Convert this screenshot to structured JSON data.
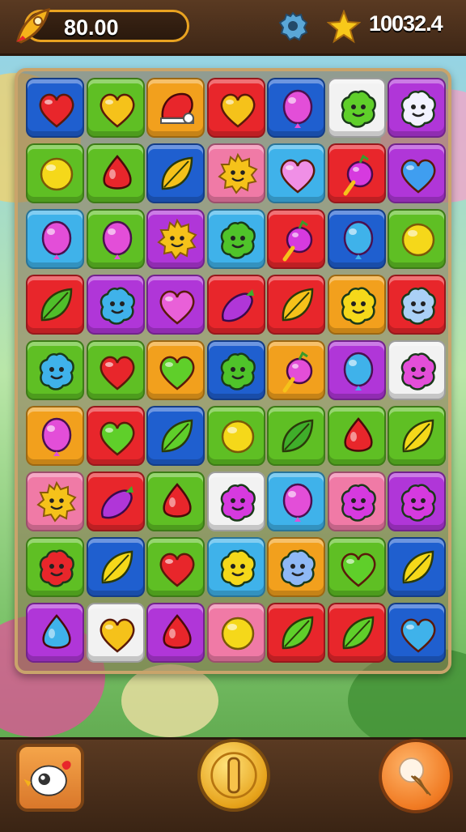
{
  "hud": {
    "coins": "80.00",
    "score": "10032.4",
    "coin_icon": "rocket-icon",
    "settings_icon": "gear-icon",
    "score_icon": "star-icon"
  },
  "colors": {
    "red": "#e8262b",
    "green": "#5fbf24",
    "orange": "#f2a01d",
    "blue": "#1f5fcf",
    "white": "#f2f2f2",
    "purple": "#b036d8",
    "cyan": "#3fb2ea",
    "pink": "#f07aa6"
  },
  "board": {
    "rows": [
      [
        {
          "bg": "blue",
          "icon": "heart",
          "c": "#e8262b"
        },
        {
          "bg": "green",
          "icon": "heart",
          "c": "#f5c21a"
        },
        {
          "bg": "orange",
          "icon": "cap",
          "c": "#e8262b"
        },
        {
          "bg": "red",
          "icon": "heart",
          "c": "#f5c21a"
        },
        {
          "bg": "blue",
          "icon": "balloon",
          "c": "#e34ed8"
        },
        {
          "bg": "white",
          "icon": "face-blob",
          "c": "#5fcf2a"
        },
        {
          "bg": "purple",
          "icon": "face-blob",
          "c": "#f2f2ff"
        }
      ],
      [
        {
          "bg": "green",
          "icon": "ball",
          "c": "#f5d81a"
        },
        {
          "bg": "green",
          "icon": "drop",
          "c": "#e8262b"
        },
        {
          "bg": "blue",
          "icon": "leaf",
          "c": "#f5c21a"
        },
        {
          "bg": "pink",
          "icon": "sun-face",
          "c": "#f5c21a"
        },
        {
          "bg": "cyan",
          "icon": "heart",
          "c": "#f08fe6"
        },
        {
          "bg": "red",
          "icon": "berry",
          "c": "#d63adf"
        },
        {
          "bg": "purple",
          "icon": "heart",
          "c": "#3f9ef0"
        }
      ],
      [
        {
          "bg": "cyan",
          "icon": "balloon",
          "c": "#e34ed8"
        },
        {
          "bg": "green",
          "icon": "balloon",
          "c": "#e34ed8"
        },
        {
          "bg": "purple",
          "icon": "sun-face",
          "c": "#f5c21a"
        },
        {
          "bg": "cyan",
          "icon": "face-blob",
          "c": "#4fc32a"
        },
        {
          "bg": "red",
          "icon": "berry",
          "c": "#d63adf"
        },
        {
          "bg": "blue",
          "icon": "balloon",
          "c": "#3fb2ea"
        },
        {
          "bg": "green",
          "icon": "ball",
          "c": "#f5d81a"
        }
      ],
      [
        {
          "bg": "red",
          "icon": "leaf",
          "c": "#4fbf2a"
        },
        {
          "bg": "purple",
          "icon": "face-blob",
          "c": "#3fb2ea"
        },
        {
          "bg": "purple",
          "icon": "heart",
          "c": "#e960d8"
        },
        {
          "bg": "red",
          "icon": "eggplant",
          "c": "#b036d8"
        },
        {
          "bg": "red",
          "icon": "leaf",
          "c": "#f5c21a"
        },
        {
          "bg": "orange",
          "icon": "face-blob",
          "c": "#f5d81a"
        },
        {
          "bg": "red",
          "icon": "face-blob",
          "c": "#aad0f5"
        }
      ],
      [
        {
          "bg": "green",
          "icon": "face-blob",
          "c": "#3fb2ea"
        },
        {
          "bg": "green",
          "icon": "heart",
          "c": "#e8262b"
        },
        {
          "bg": "orange",
          "icon": "heart",
          "c": "#5fcf2a"
        },
        {
          "bg": "blue",
          "icon": "face-blob",
          "c": "#4fc32a"
        },
        {
          "bg": "orange",
          "icon": "berry",
          "c": "#e34ed8"
        },
        {
          "bg": "purple",
          "icon": "balloon",
          "c": "#3fb2ea"
        },
        {
          "bg": "white",
          "icon": "face-blob",
          "c": "#e34ed8"
        }
      ],
      [
        {
          "bg": "orange",
          "icon": "balloon",
          "c": "#e34ed8"
        },
        {
          "bg": "red",
          "icon": "heart",
          "c": "#5fcf2a"
        },
        {
          "bg": "blue",
          "icon": "leaf",
          "c": "#5fcf2a"
        },
        {
          "bg": "green",
          "icon": "ball",
          "c": "#f5d81a"
        },
        {
          "bg": "green",
          "icon": "leaf",
          "c": "#3fae2a"
        },
        {
          "bg": "green",
          "icon": "drop",
          "c": "#e8262b"
        },
        {
          "bg": "green",
          "icon": "leaf",
          "c": "#f5d81a"
        }
      ],
      [
        {
          "bg": "pink",
          "icon": "sun-face",
          "c": "#f5c21a"
        },
        {
          "bg": "red",
          "icon": "eggplant",
          "c": "#b036d8"
        },
        {
          "bg": "green",
          "icon": "drop",
          "c": "#e8262b"
        },
        {
          "bg": "white",
          "icon": "face-blob",
          "c": "#d63adf"
        },
        {
          "bg": "cyan",
          "icon": "balloon",
          "c": "#e34ed8"
        },
        {
          "bg": "pink",
          "icon": "face-blob",
          "c": "#d63adf"
        },
        {
          "bg": "purple",
          "icon": "face-blob",
          "c": "#d63adf"
        }
      ],
      [
        {
          "bg": "green",
          "icon": "face-blob",
          "c": "#e8262b"
        },
        {
          "bg": "blue",
          "icon": "leaf",
          "c": "#f5d81a"
        },
        {
          "bg": "green",
          "icon": "heart",
          "c": "#e8262b"
        },
        {
          "bg": "cyan",
          "icon": "face-blob",
          "c": "#f5d81a"
        },
        {
          "bg": "orange",
          "icon": "face-blob",
          "c": "#8fb8f5"
        },
        {
          "bg": "green",
          "icon": "heart",
          "c": "#5fcf2a"
        },
        {
          "bg": "blue",
          "icon": "leaf",
          "c": "#f5d81a"
        }
      ],
      [
        {
          "bg": "purple",
          "icon": "drop",
          "c": "#3fb2ea"
        },
        {
          "bg": "white",
          "icon": "heart",
          "c": "#f5c21a"
        },
        {
          "bg": "purple",
          "icon": "drop",
          "c": "#e8262b"
        },
        {
          "bg": "pink",
          "icon": "ball",
          "c": "#f5d81a"
        },
        {
          "bg": "red",
          "icon": "leaf",
          "c": "#5fcf2a"
        },
        {
          "bg": "red",
          "icon": "leaf",
          "c": "#5fcf2a"
        },
        {
          "bg": "blue",
          "icon": "heart",
          "c": "#3fb2ea"
        }
      ]
    ]
  },
  "bottom": {
    "left_icon": "bird-icon",
    "middle_icon": "pause-coin-icon",
    "right_icon": "ice-cream-icon"
  }
}
